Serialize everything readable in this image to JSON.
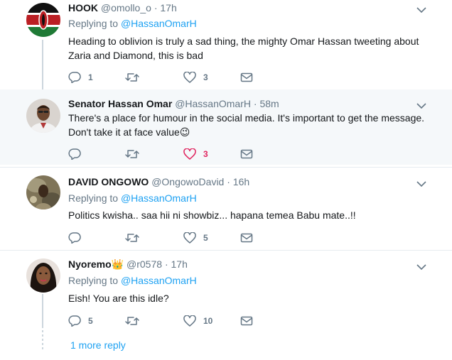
{
  "tweets": [
    {
      "name": "HOOK",
      "handle": "@omollo_o",
      "dot": "·",
      "time": "17h",
      "replying_label": "Replying to",
      "replying_to": "@HassanOmarH",
      "text": "Heading to oblivion is truly a sad thing, the mighty Omar Hassan tweeting about Zaria and Diamond, this is bad",
      "replies": "1",
      "retweets": "",
      "likes": "3",
      "liked": false
    },
    {
      "name": "Senator Hassan Omar",
      "handle": "@HassanOmarH",
      "dot": "·",
      "time": "58m",
      "text": "There's a place for humour in the social media. It's important to get the message. Don't take it at face value",
      "emoji": "😉",
      "replies": "",
      "retweets": "",
      "likes": "3",
      "liked": true
    },
    {
      "name": "DAVID ONGOWO",
      "handle": "@OngowoDavid",
      "dot": "·",
      "time": "16h",
      "replying_label": "Replying to",
      "replying_to": "@HassanOmarH",
      "text": "Politics kwisha.. saa hii ni showbiz... hapana temea Babu mate..!!",
      "replies": "",
      "retweets": "",
      "likes": "5",
      "liked": false
    },
    {
      "name": "Nyoremo",
      "name_emoji": "👑",
      "handle": "@r0578",
      "dot": "·",
      "time": "17h",
      "replying_label": "Replying to",
      "replying_to": "@HassanOmarH",
      "text": "Eish! You are this idle?",
      "replies": "5",
      "retweets": "",
      "likes": "10",
      "liked": false
    }
  ],
  "more_reply": "1 more reply",
  "colors": {
    "accent": "#1da1f2",
    "like": "#e0245e",
    "muted": "#657786",
    "highlight_bg": "#f5f8fa",
    "divider": "#e6ecf0"
  },
  "icons": [
    "reply-icon",
    "retweet-icon",
    "like-icon",
    "dm-icon",
    "chevron-down-icon"
  ]
}
